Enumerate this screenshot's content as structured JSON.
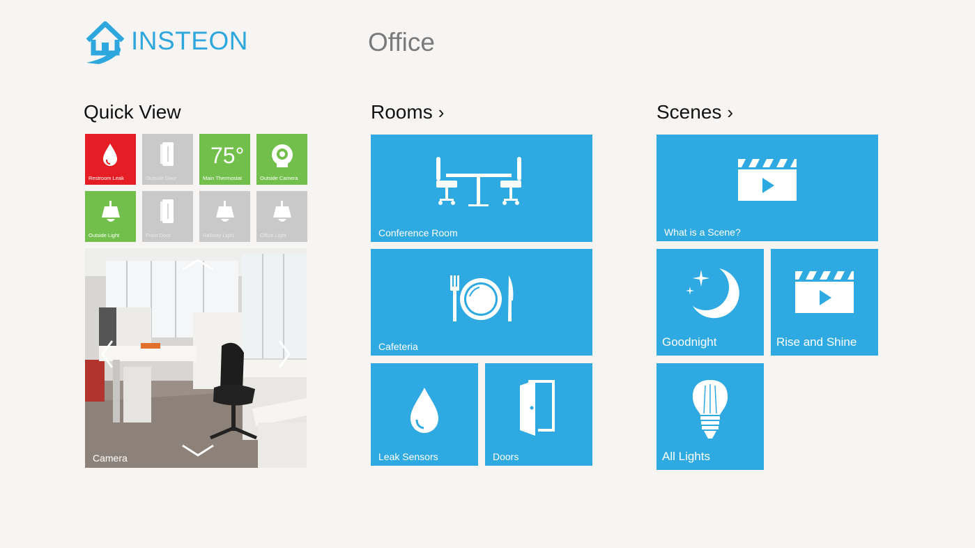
{
  "brand": {
    "name": "INSTEON",
    "color": "#2da7de"
  },
  "location": "Office",
  "sections": {
    "quick_view": "Quick View",
    "rooms": "Rooms",
    "scenes": "Scenes",
    "chevron": "›"
  },
  "quick_view": {
    "tiles": [
      {
        "label": "Restroom Leak",
        "icon": "water-drop-icon",
        "color": "#e51e25"
      },
      {
        "label": "Outside Door",
        "icon": "door-sensor-icon",
        "color": "#c9c9c9"
      },
      {
        "label": "Main Thermostat",
        "value": "75°",
        "color": "#72c04b"
      },
      {
        "label": "Outside Camera",
        "icon": "camera-icon",
        "color": "#72c04b"
      },
      {
        "label": "Outside Light",
        "icon": "lamp-icon",
        "color": "#72c04b"
      },
      {
        "label": "Front Door",
        "icon": "door-sensor-icon",
        "color": "#c9c9c9"
      },
      {
        "label": "Hallway Light",
        "icon": "lamp-icon",
        "color": "#c9c9c9"
      },
      {
        "label": "Office Light",
        "icon": "lamp-icon",
        "color": "#c9c9c9"
      }
    ],
    "camera": {
      "label": "Camera"
    }
  },
  "rooms": {
    "tiles": [
      {
        "label": "Conference Room",
        "icon": "conference-table-icon"
      },
      {
        "label": "Cafeteria",
        "icon": "plate-cutlery-icon"
      },
      {
        "label": "Leak Sensors",
        "icon": "water-drop-icon"
      },
      {
        "label": "Doors",
        "icon": "open-door-icon"
      }
    ]
  },
  "scenes": {
    "tiles": [
      {
        "label": "What is a Scene?",
        "icon": "video-clapper-icon"
      },
      {
        "label": "Goodnight",
        "icon": "moon-stars-icon"
      },
      {
        "label": "Rise and Shine",
        "icon": "video-clapper-icon"
      },
      {
        "label": "All Lights",
        "icon": "light-bulb-icon"
      }
    ]
  },
  "tile_color": "#2ea9e1"
}
